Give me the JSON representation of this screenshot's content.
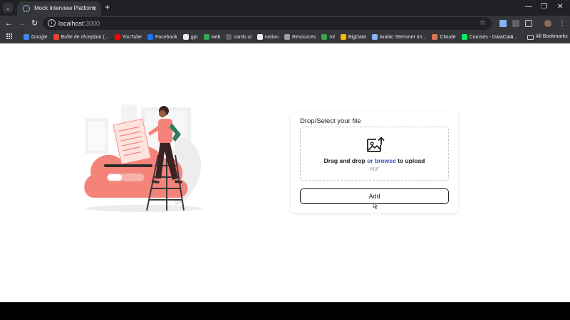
{
  "browser": {
    "tab_title": "Mock Interview Platform",
    "tab_close": "✕",
    "new_tab": "+",
    "window_controls": [
      "—",
      "❐",
      "✕"
    ],
    "url_host": "localhost",
    "url_port": ":3000",
    "bookmarks": [
      {
        "label": "Google",
        "color": "#4285f4"
      },
      {
        "label": "Boîte de réception (...",
        "color": "#ea4335"
      },
      {
        "label": "YouTube",
        "color": "#ff0000"
      },
      {
        "label": "Facebook",
        "color": "#1877f2"
      },
      {
        "label": "gpt",
        "color": "#e8eaed"
      },
      {
        "label": "web",
        "color": "#34a853"
      },
      {
        "label": "cards ui",
        "color": "#5f6368"
      },
      {
        "label": "notion",
        "color": "#e8eaed"
      },
      {
        "label": "Resources",
        "color": "#9aa0a6"
      },
      {
        "label": "ml",
        "color": "#34a853"
      },
      {
        "label": "BigData",
        "color": "#fbbc04"
      },
      {
        "label": "Arabic Stemmer Im...",
        "color": "#8ab4f8"
      },
      {
        "label": "Claude",
        "color": "#d97757"
      },
      {
        "label": "Courses - DataCam...",
        "color": "#03ef62"
      }
    ],
    "bookmarks_more": "»",
    "all_bookmarks": "All Bookmarks"
  },
  "upload": {
    "title": "Drop/Select your file",
    "drag_text": "Drag and drop ",
    "browse_text": "or browse",
    "upload_text": " to upload",
    "format_hint": "PDF",
    "add_label": "Add"
  },
  "colors": {
    "accent": "#3b52b4",
    "illustration_primary": "#f4837a",
    "browser_dark": "#202124",
    "browser_toolbar": "#35363a"
  }
}
